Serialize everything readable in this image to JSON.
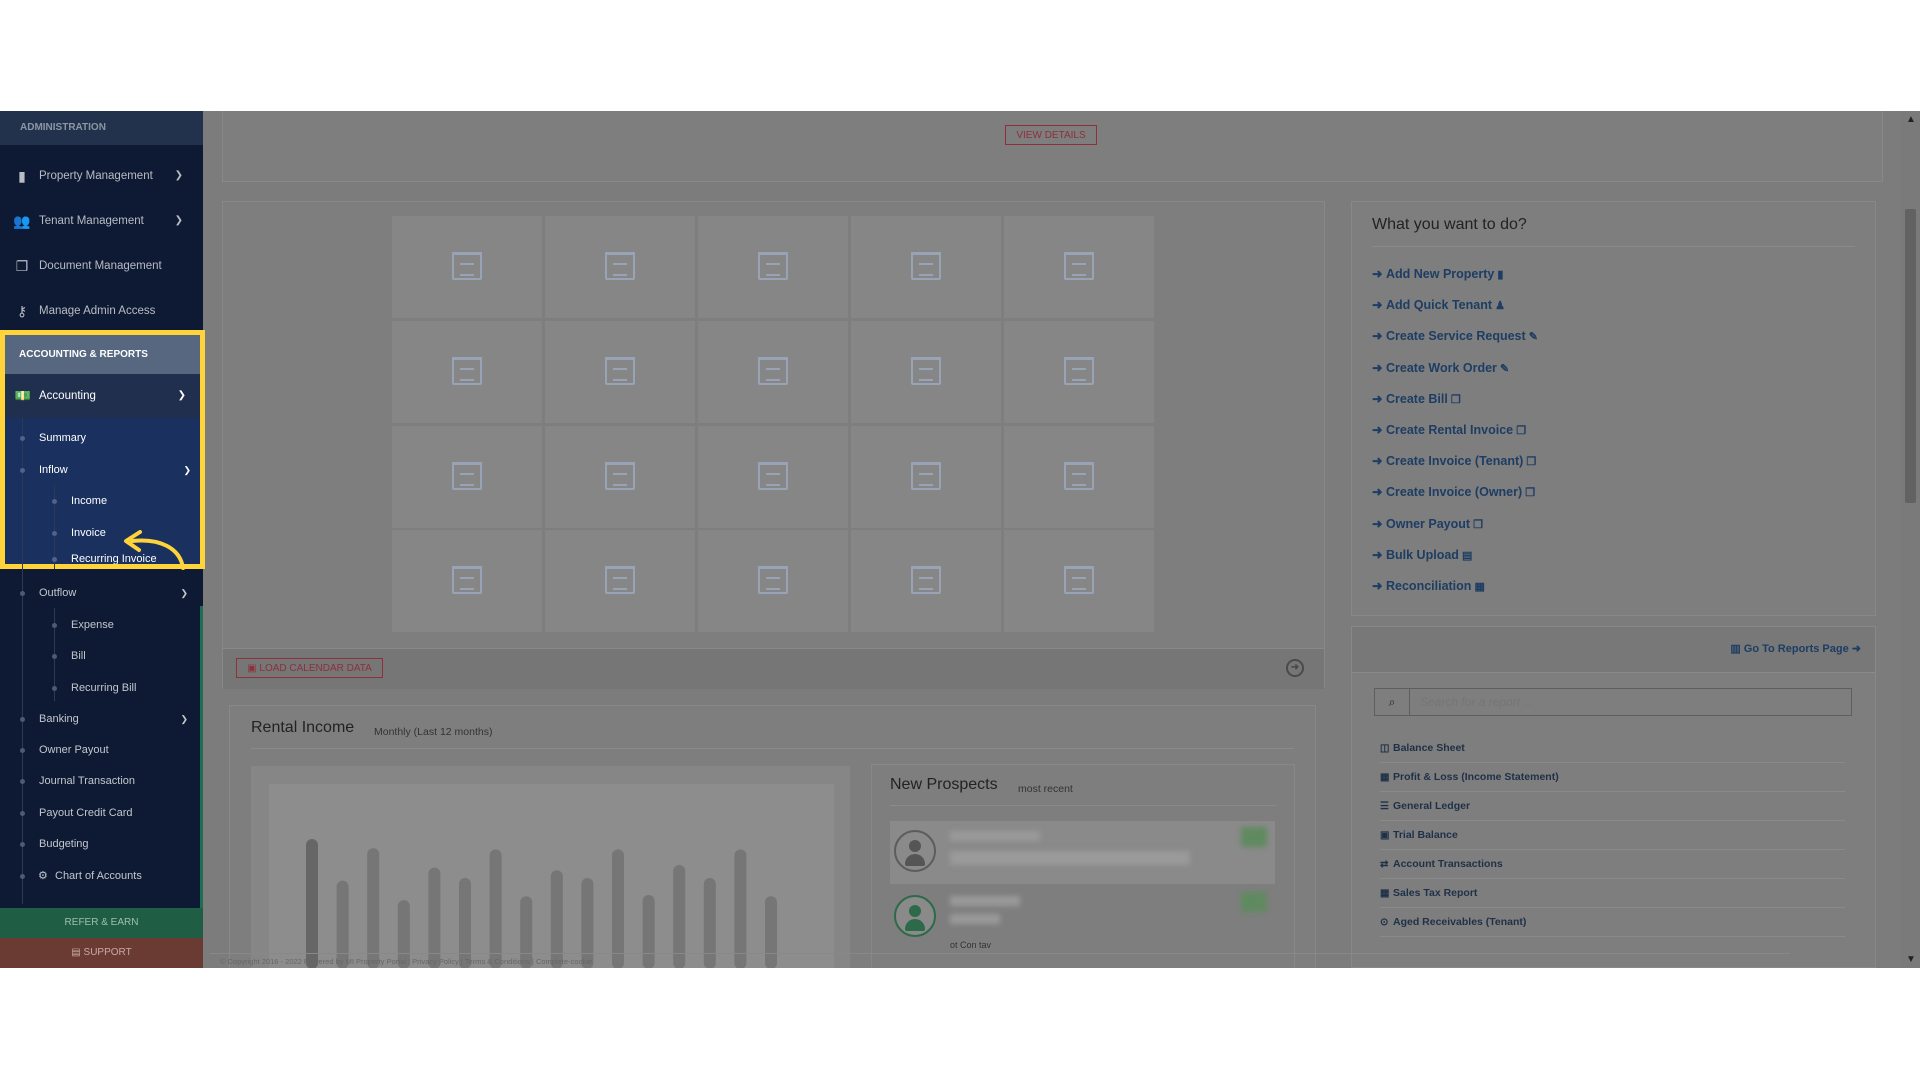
{
  "sidebar": {
    "administration_header": "ADMINISTRATION",
    "admin_items": [
      {
        "label": "Property Management",
        "icon": "building-icon",
        "has_chevron": true
      },
      {
        "label": "Tenant Management",
        "icon": "users-icon",
        "has_chevron": true
      },
      {
        "label": "Document Management",
        "icon": "documents-icon",
        "has_chevron": false
      },
      {
        "label": "Manage Admin Access",
        "icon": "key-icon",
        "has_chevron": false
      }
    ],
    "accounting_header": "ACCOUNTING & REPORTS",
    "accounting_label": "Accounting",
    "summary": "Summary",
    "inflow": "Inflow",
    "income": "Income",
    "invoice": "Invoice",
    "recurring_invoice": "Recurring Invoice",
    "outflow": "Outflow",
    "expense": "Expense",
    "bill": "Bill",
    "recurring_bill": "Recurring Bill",
    "banking": "Banking",
    "owner_payout": "Owner Payout",
    "journal_transaction": "Journal Transaction",
    "payout_credit_card": "Payout Credit Card",
    "budgeting": "Budgeting",
    "chart_of_accounts": "Chart of Accounts",
    "refer_earn": "REFER & EARN",
    "support": "SUPPORT"
  },
  "top": {
    "view_details": "VIEW DETAILS"
  },
  "calendar": {
    "load_button": "LOAD CALENDAR DATA"
  },
  "actions": {
    "title": "What you want to do?",
    "items": [
      "Add New Property",
      "Add Quick Tenant",
      "Create Service Request",
      "Create Work Order",
      "Create Bill",
      "Create Rental Invoice",
      "Create Invoice (Tenant)",
      "Create Invoice (Owner)",
      "Owner Payout",
      "Bulk Upload",
      "Reconciliation"
    ]
  },
  "reports": {
    "go_link": "Go To Reports Page",
    "search_placeholder": "Search for a report ...",
    "items": [
      "Balance Sheet",
      "Profit & Loss (Income Statement)",
      "General Ledger",
      "Trial Balance",
      "Account Transactions",
      "Sales Tax Report",
      "Aged Receivables (Tenant)"
    ]
  },
  "income": {
    "title": "Rental Income",
    "subtitle": "Monthly (Last 12 months)"
  },
  "prospects": {
    "title": "New Prospects",
    "subtitle": "most recent",
    "partial_text": "ot Con tav"
  },
  "footer": {
    "text": "© Copyright 2016 - 2022 Powered by MI Property Portal | Privacy Policy | Terms & Conditions | Complete-cookie"
  },
  "chart_data": {
    "type": "bar",
    "title": "Rental Income",
    "subtitle": "Monthly (Last 12 months)",
    "values": [
      100,
      68,
      93,
      53,
      78,
      70,
      92,
      56,
      76,
      70,
      92,
      57,
      80,
      70,
      92,
      56
    ],
    "ylim": [
      0,
      110
    ]
  },
  "colors": {
    "highlight": "#ffd33a",
    "sidebar_bg": "#0e1a33",
    "accent_red": "#8e2f3a",
    "link_blue": "#1d3d63"
  }
}
